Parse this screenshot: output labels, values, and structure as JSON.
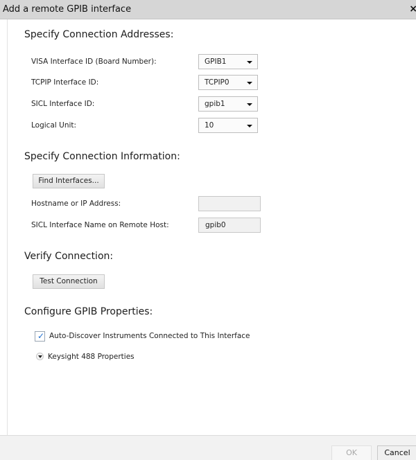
{
  "dialog": {
    "title": "Add a remote GPIB interface",
    "close_glyph": "×"
  },
  "addresses": {
    "heading": "Specify Connection Addresses:",
    "visa_label": "VISA Interface ID (Board Number):",
    "visa_value": "GPIB1",
    "tcpip_label": "TCPIP Interface ID:",
    "tcpip_value": "TCPIP0",
    "sicl_label": "SICL Interface ID:",
    "sicl_value": "gpib1",
    "lu_label": "Logical Unit:",
    "lu_value": "10"
  },
  "information": {
    "heading": "Specify Connection Information:",
    "find_button": "Find Interfaces...",
    "hostname_label": "Hostname or IP Address:",
    "hostname_value": "",
    "remote_name_label": "SICL Interface Name on Remote Host:",
    "remote_name_value": "gpib0"
  },
  "verify": {
    "heading": "Verify Connection:",
    "test_button": "Test Connection"
  },
  "gpib": {
    "heading": "Configure GPIB Properties:",
    "autodiscover_label": "Auto-Discover Instruments Connected to This Interface",
    "autodiscover_checked": true,
    "expander_label": "Keysight 488 Properties"
  },
  "footer": {
    "ok": "OK",
    "cancel": "Cancel"
  },
  "icons": {
    "check": "check-icon",
    "caret": "chevron-down-icon",
    "close": "close-icon"
  }
}
